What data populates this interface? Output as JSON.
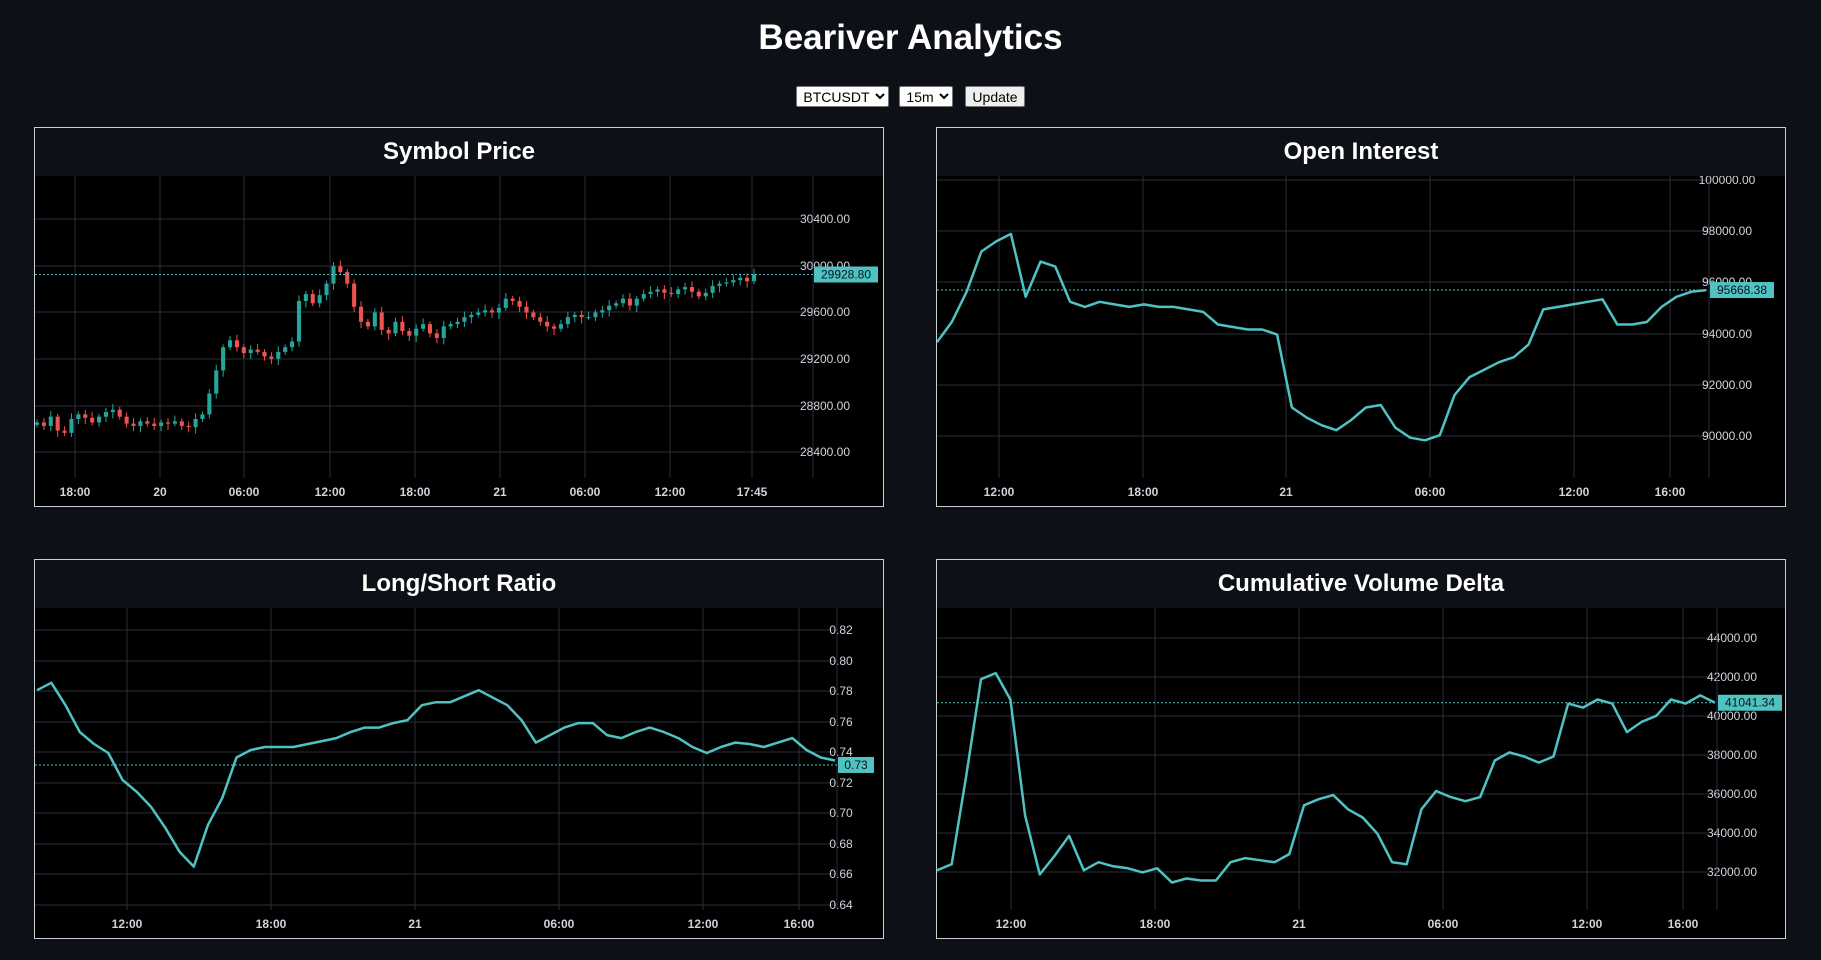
{
  "app": {
    "title": "Beariver Analytics"
  },
  "controls": {
    "symbol": {
      "selected": "BTCUSDT",
      "options": [
        "BTCUSDT"
      ]
    },
    "interval": {
      "selected": "15m",
      "options": [
        "15m"
      ]
    },
    "update_label": "Update"
  },
  "colors": {
    "background": "#0d1117",
    "chart_background": "#000000",
    "line": "#4fc3c3",
    "candle_up": "#26a69a",
    "candle_down": "#ef5350",
    "grid": "#2a2e39"
  },
  "chart_data": [
    {
      "id": "price",
      "type": "candlestick",
      "title": "Symbol Price",
      "x_ticks": [
        "18:00",
        "20",
        "06:00",
        "12:00",
        "18:00",
        "21",
        "06:00",
        "12:00",
        "17:45"
      ],
      "y_ticks": [
        "30400.00",
        "30000.00",
        "29600.00",
        "29200.00",
        "28800.00",
        "28400.00"
      ],
      "ylim": [
        28170,
        30780
      ],
      "last_value": "29928.80",
      "grid": true,
      "series": [
        {
          "name": "",
          "values": [
            28650,
            28620,
            28700,
            28580,
            28560,
            28680,
            28720,
            28690,
            28650,
            28700,
            28740,
            28760,
            28700,
            28640,
            28620,
            28660,
            28640,
            28620,
            28650,
            28640,
            28660,
            28620,
            28610,
            28680,
            28720,
            28900,
            29100,
            29300,
            29360,
            29300,
            29250,
            29280,
            29260,
            29220,
            29200,
            29260,
            29300,
            29350,
            29700,
            29760,
            29680,
            29750,
            29850,
            30000,
            29950,
            29850,
            29650,
            29520,
            29480,
            29600,
            29450,
            29420,
            29520,
            29440,
            29400,
            29460,
            29500,
            29420,
            29380,
            29480,
            29500,
            29520,
            29560,
            29580,
            29600,
            29620,
            29600,
            29640,
            29720,
            29700,
            29650,
            29600,
            29560,
            29520,
            29480,
            29460,
            29500,
            29560,
            29580,
            29560,
            29560,
            29600,
            29620,
            29660,
            29680,
            29720,
            29660,
            29720,
            29760,
            29780,
            29800,
            29770,
            29760,
            29800,
            29820,
            29780,
            29740,
            29770,
            29830,
            29850,
            29860,
            29880,
            29900,
            29870,
            29930
          ]
        }
      ]
    },
    {
      "id": "open-interest",
      "type": "line",
      "title": "Open Interest",
      "x_ticks": [
        "12:00",
        "18:00",
        "21",
        "06:00",
        "12:00",
        "16:00"
      ],
      "y_ticks": [
        "100000.00",
        "98000.00",
        "96000.00",
        "94000.00",
        "92000.00",
        "90000.00"
      ],
      "ylim": [
        88200,
        100200
      ],
      "last_value": "95668.38",
      "grid": true,
      "series": [
        {
          "name": "",
          "values": [
            93600,
            94400,
            95600,
            97200,
            97600,
            97900,
            95400,
            96800,
            96600,
            95200,
            95000,
            95200,
            95100,
            95000,
            95100,
            95000,
            95000,
            94900,
            94800,
            94300,
            94200,
            94100,
            94100,
            93900,
            91000,
            90600,
            90300,
            90100,
            90500,
            91000,
            91100,
            90200,
            89800,
            89700,
            89900,
            91500,
            92200,
            92500,
            92800,
            93000,
            93500,
            94900,
            95000,
            95100,
            95200,
            95300,
            94300,
            94300,
            94400,
            95000,
            95400,
            95600,
            95668
          ]
        }
      ]
    },
    {
      "id": "long-short-ratio",
      "type": "line",
      "title": "Long/Short Ratio",
      "x_ticks": [
        "12:00",
        "18:00",
        "21",
        "06:00",
        "12:00",
        "16:00"
      ],
      "y_ticks": [
        "0.82",
        "0.80",
        "0.78",
        "0.76",
        "0.74",
        "0.72",
        "0.70",
        "0.68",
        "0.66",
        "0.64"
      ],
      "ylim": [
        0.633,
        0.835
      ],
      "last_value": "0.73",
      "grid": true,
      "series": [
        {
          "name": "",
          "values": [
            0.78,
            0.785,
            0.77,
            0.752,
            0.744,
            0.738,
            0.72,
            0.712,
            0.702,
            0.688,
            0.672,
            0.662,
            0.69,
            0.708,
            0.735,
            0.74,
            0.742,
            0.742,
            0.742,
            0.744,
            0.746,
            0.748,
            0.752,
            0.755,
            0.755,
            0.758,
            0.76,
            0.77,
            0.772,
            0.772,
            0.776,
            0.78,
            0.775,
            0.77,
            0.76,
            0.745,
            0.75,
            0.755,
            0.758,
            0.758,
            0.75,
            0.748,
            0.752,
            0.755,
            0.752,
            0.748,
            0.742,
            0.738,
            0.742,
            0.745,
            0.744,
            0.742,
            0.745,
            0.748,
            0.74,
            0.735,
            0.733
          ]
        }
      ]
    },
    {
      "id": "cumulative-volume-delta",
      "type": "line",
      "title": "Cumulative Volume Delta",
      "x_ticks": [
        "12:00",
        "18:00",
        "21",
        "06:00",
        "12:00",
        "16:00"
      ],
      "y_ticks": [
        "44000.00",
        "42000.00",
        "40000.00",
        "38000.00",
        "36000.00",
        "34000.00",
        "32000.00"
      ],
      "ylim": [
        30850,
        45700
      ],
      "last_value": "41041.34",
      "grid": true,
      "series": [
        {
          "name": "",
          "values": [
            32800,
            33100,
            37500,
            42200,
            42500,
            41200,
            35500,
            32600,
            33500,
            34500,
            32800,
            33200,
            33000,
            32900,
            32700,
            32900,
            32200,
            32400,
            32300,
            32300,
            33200,
            33400,
            33300,
            33200,
            33600,
            36000,
            36300,
            36500,
            35800,
            35400,
            34600,
            33200,
            33100,
            35800,
            36700,
            36400,
            36200,
            36400,
            38200,
            38600,
            38400,
            38100,
            38400,
            41000,
            40800,
            41200,
            41000,
            39600,
            40100,
            40400,
            41200,
            41000,
            41400,
            41041
          ]
        }
      ]
    }
  ]
}
